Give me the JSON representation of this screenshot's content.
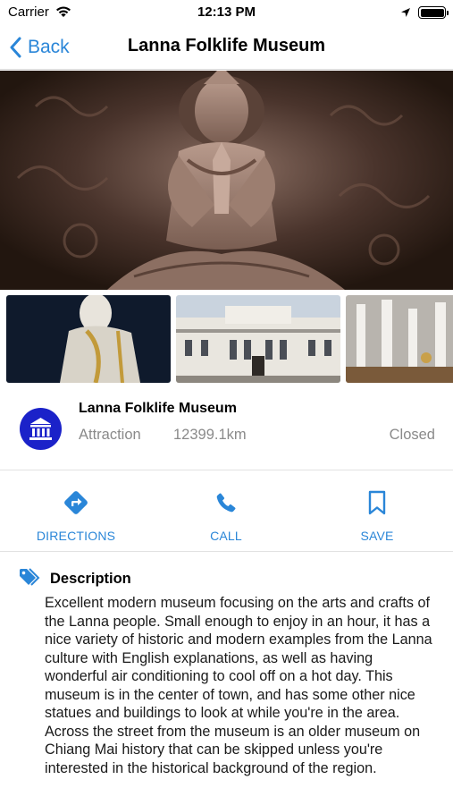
{
  "status_bar": {
    "carrier": "Carrier",
    "time": "12:13 PM"
  },
  "nav": {
    "back_label": "Back",
    "title": "Lanna Folklife Museum"
  },
  "gallery": {
    "hero": "carved-buddha-relief",
    "thumbnails": [
      "white-buddha-statue",
      "museum-building",
      "white-temple-pillars"
    ]
  },
  "place": {
    "name": "Lanna Folklife Museum",
    "category": "Attraction",
    "distance": "12399.1km",
    "status": "Closed",
    "icon": "museum-icon",
    "icon_color": "#1b22c9"
  },
  "actions": [
    {
      "label": "DIRECTIONS",
      "icon": "directions-icon"
    },
    {
      "label": "CALL",
      "icon": "phone-icon"
    },
    {
      "label": "SAVE",
      "icon": "bookmark-icon"
    }
  ],
  "description": {
    "title": "Description",
    "text": "Excellent modern museum focusing on the arts and crafts of the Lanna people. Small enough to enjoy in an hour, it has a nice variety of historic and modern examples from the Lanna culture with English explanations, as well as having wonderful air conditioning to cool off on a hot day. This museum is in the center of town, and has some other nice statues and buildings to look at while you're in the area. Across the street from the museum is an older museum on Chiang Mai history that can be skipped unless you're interested in the historical background of the region."
  },
  "colors": {
    "accent": "#2a86d8",
    "secondary_text": "#8a8a8a"
  }
}
